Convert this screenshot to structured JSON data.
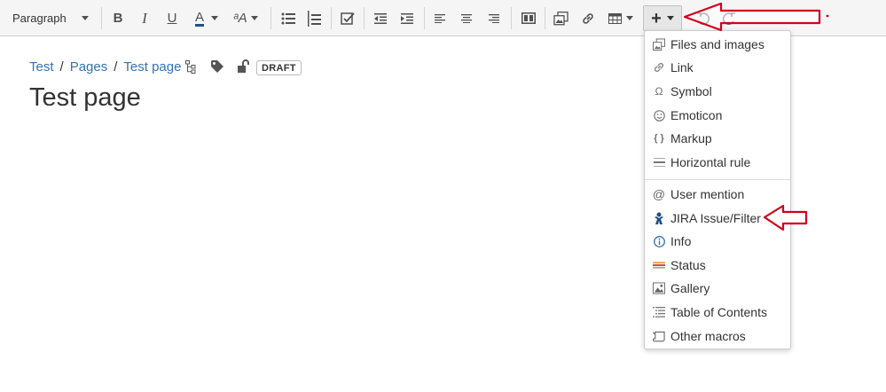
{
  "toolbar": {
    "paragraph_label": "Paragraph",
    "bold": "B",
    "italic": "I",
    "underline": "U",
    "text_color": "A",
    "more_formatting": "ᵃA"
  },
  "breadcrumb": {
    "items": [
      "Test",
      "Pages",
      "Test page"
    ],
    "separator": "/"
  },
  "page": {
    "status": "DRAFT",
    "title": "Test page"
  },
  "insert_menu": {
    "items": [
      {
        "label": "Files and images",
        "icon": "files-images-icon"
      },
      {
        "label": "Link",
        "icon": "link-icon"
      },
      {
        "label": "Symbol",
        "icon": "omega-icon"
      },
      {
        "label": "Emoticon",
        "icon": "smiley-icon"
      },
      {
        "label": "Markup",
        "icon": "braces-icon"
      },
      {
        "label": "Horizontal rule",
        "icon": "horizontal-rule-icon"
      },
      {
        "label": "User mention",
        "icon": "at-icon"
      },
      {
        "label": "JIRA Issue/Filter",
        "icon": "jira-icon"
      },
      {
        "label": "Info",
        "icon": "info-icon"
      },
      {
        "label": "Status",
        "icon": "status-icon"
      },
      {
        "label": "Gallery",
        "icon": "gallery-icon"
      },
      {
        "label": "Table of Contents",
        "icon": "toc-icon"
      },
      {
        "label": "Other macros",
        "icon": "scroll-icon"
      }
    ]
  },
  "colors": {
    "link": "#3572b0",
    "annotation": "#d0021b",
    "toolbar_bg": "#f5f5f5"
  }
}
